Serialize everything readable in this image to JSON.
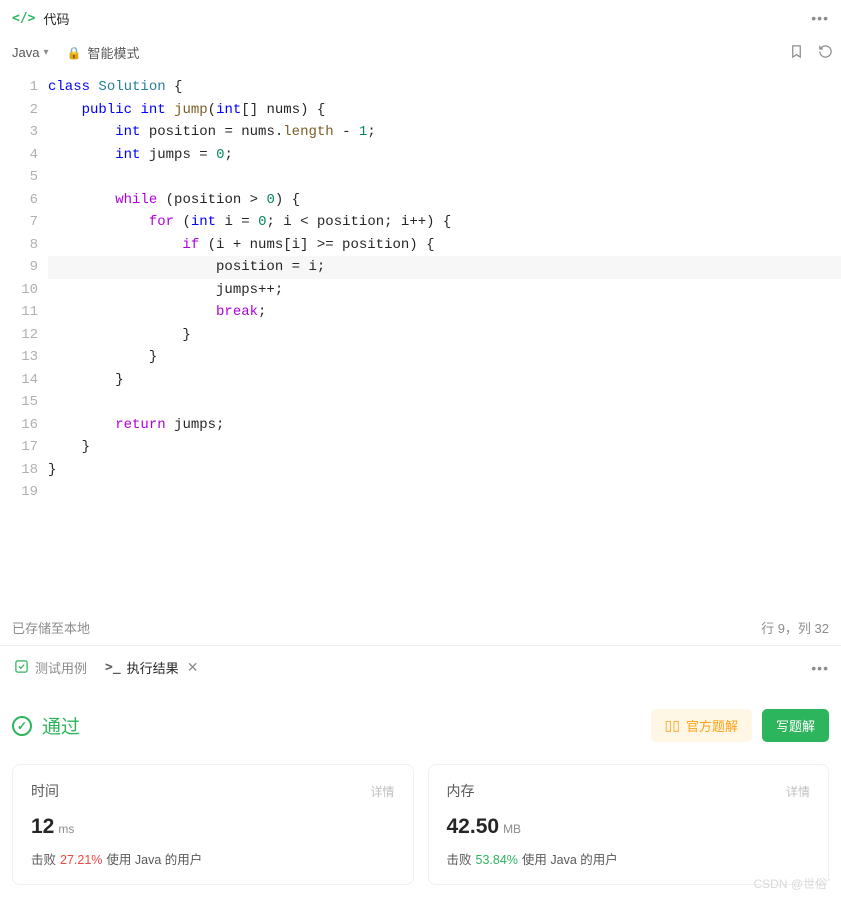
{
  "header": {
    "title": "代码"
  },
  "toolbar": {
    "language": "Java",
    "smart_mode": "智能模式"
  },
  "code": {
    "lines": [
      "class Solution {",
      "    public int jump(int[] nums) {",
      "        int position = nums.length - 1;",
      "        int jumps = 0;",
      "",
      "        while (position > 0) {",
      "            for (int i = 0; i < position; i++) {",
      "                if (i + nums[i] >= position) {",
      "                    position = i;",
      "                    jumps++;",
      "                    break;",
      "                }",
      "            }",
      "        }",
      "",
      "        return jumps;",
      "    }",
      "}",
      ""
    ],
    "highlighted_line": 9
  },
  "status": {
    "saved": "已存储至本地",
    "cursor": "行 9，列 32"
  },
  "tabs": {
    "test_cases": "测试用例",
    "result": "执行结果"
  },
  "result": {
    "status": "通过",
    "official_solution": "官方题解",
    "write_solution": "写题解",
    "time": {
      "label": "时间",
      "detail": "详情",
      "value": "12",
      "unit": "ms",
      "beat_label": "击败",
      "beat_pct": "27.21%",
      "beat_suffix": "使用 Java 的用户"
    },
    "memory": {
      "label": "内存",
      "detail": "详情",
      "value": "42.50",
      "unit": "MB",
      "beat_label": "击败",
      "beat_pct": "53.84%",
      "beat_suffix": "使用 Java 的用户"
    }
  },
  "watermark": "CSDN @世俗ˊ"
}
